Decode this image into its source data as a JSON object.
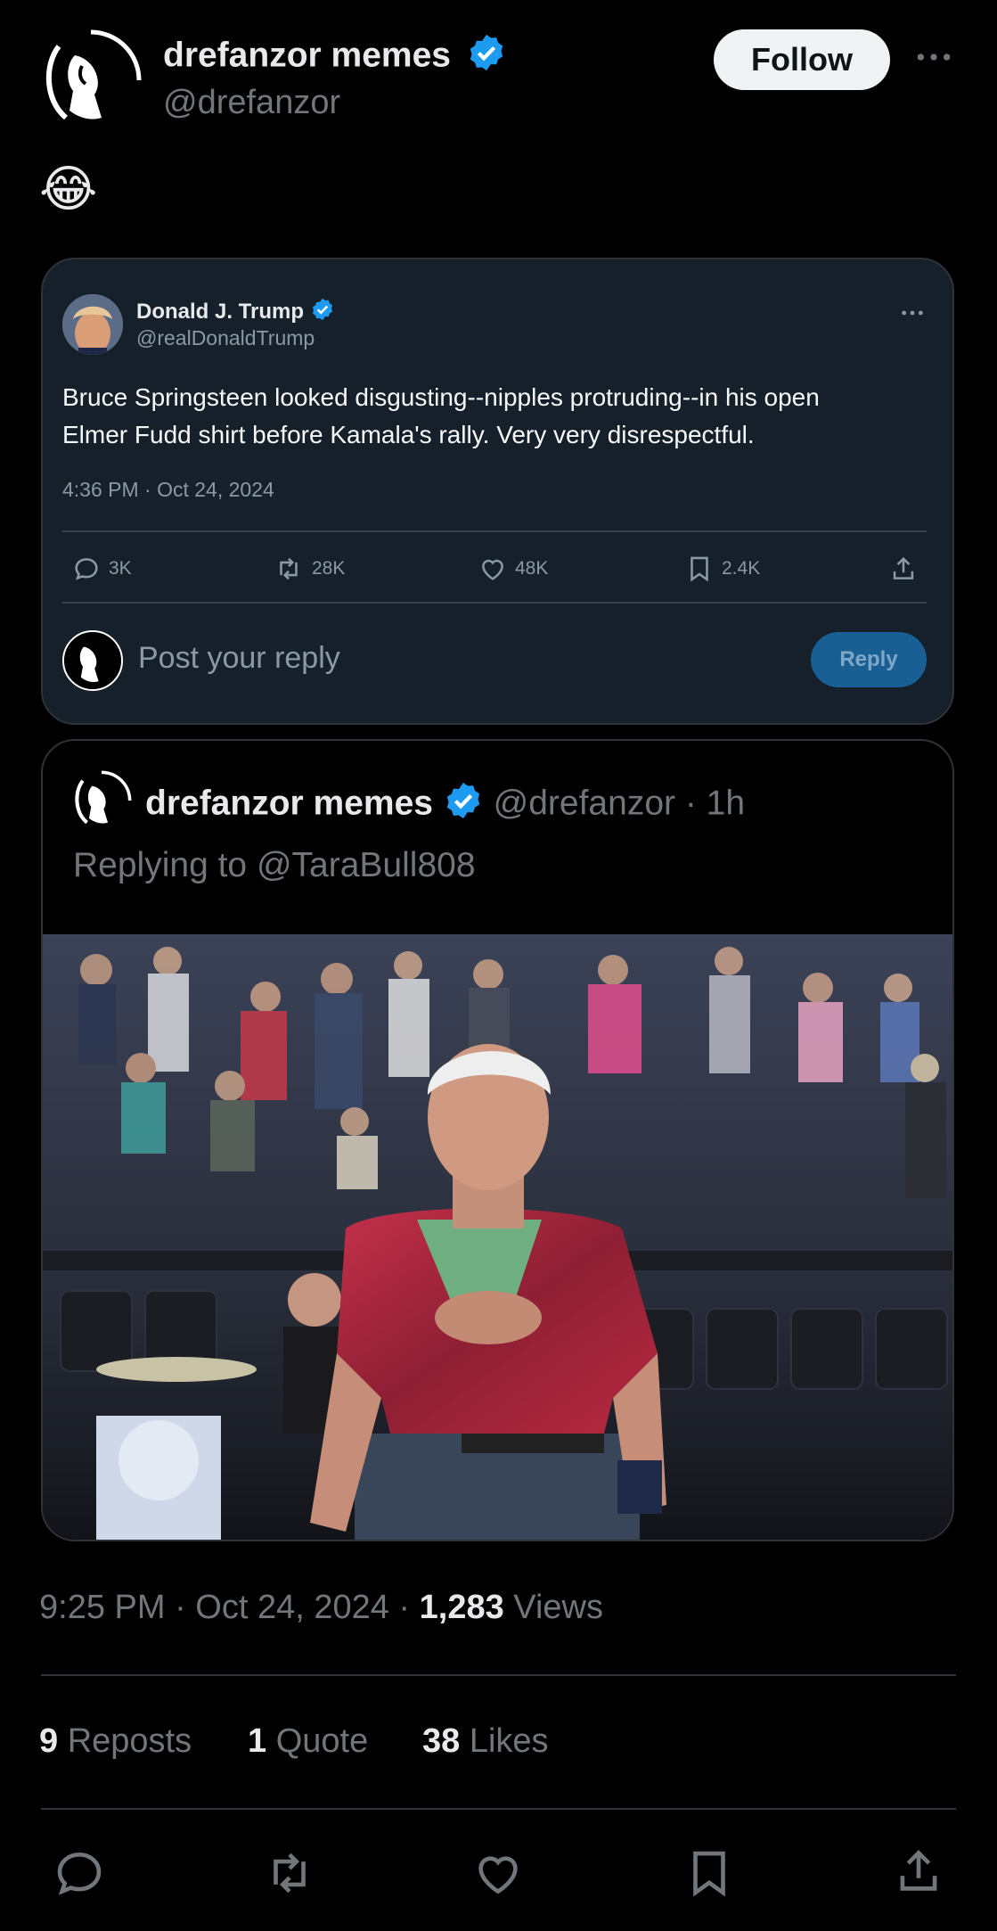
{
  "author": {
    "name": "drefanzor memes",
    "handle": "@drefanzor"
  },
  "follow_label": "Follow",
  "tweet_text": "😂",
  "quoted": {
    "name": "Donald J. Trump",
    "handle": "@realDonaldTrump",
    "text_line1": "Bruce Springsteen looked disgusting--nipples protruding--in his open",
    "text_line2": "Elmer Fudd shirt before Kamala's rally. Very very disrespectful.",
    "timestamp": "4:36 PM · Oct 24, 2024",
    "replies": "3K",
    "reposts": "28K",
    "likes": "48K",
    "bookmarks": "2.4K",
    "reply_placeholder": "Post your reply",
    "reply_button": "Reply"
  },
  "reply_card": {
    "name": "drefanzor memes",
    "handle": "@drefanzor",
    "age": "· 1h",
    "replying_to": "Replying to @TaraBull808"
  },
  "meta": {
    "time": "9:25 PM · Oct 24, 2024 · ",
    "views_count": "1,283",
    "views_label": " Views"
  },
  "stats": {
    "reposts_count": "9",
    "reposts_label": "Reposts",
    "quotes_count": "1",
    "quotes_label": "Quote",
    "likes_count": "38",
    "likes_label": "Likes"
  },
  "colors": {
    "background": "#000000",
    "card": "#15202b",
    "verified": "#1d9bf0",
    "muted": "#71767b"
  },
  "icons": [
    "reply-icon",
    "repost-icon",
    "like-icon",
    "bookmark-icon",
    "share-icon",
    "verified-icon",
    "more-icon"
  ]
}
